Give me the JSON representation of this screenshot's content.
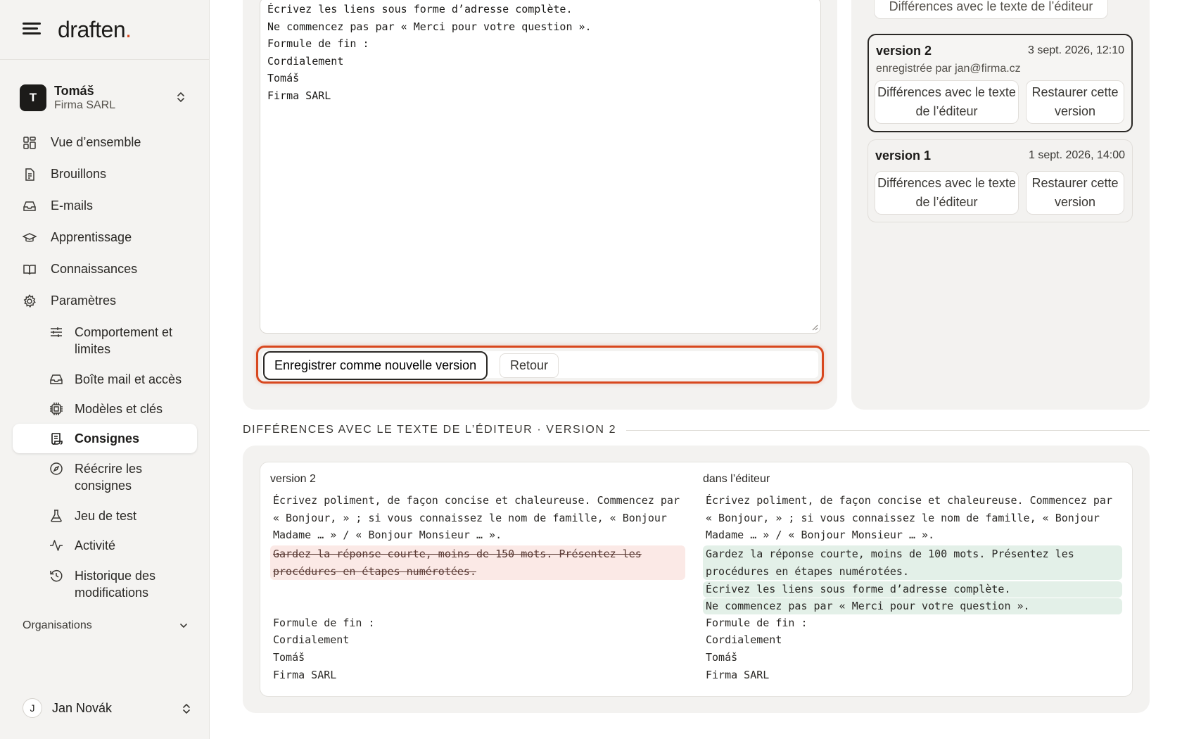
{
  "brand": {
    "name": "draften",
    "dot": "."
  },
  "account": {
    "initial": "T",
    "name": "Tomáš",
    "org": "Firma SARL"
  },
  "nav": [
    {
      "label": "Vue d’ensemble"
    },
    {
      "label": "Brouillons"
    },
    {
      "label": "E-mails"
    },
    {
      "label": "Apprentissage"
    },
    {
      "label": "Connaissances"
    },
    {
      "label": "Paramètres"
    }
  ],
  "subnav": [
    {
      "label": "Comportement et limites"
    },
    {
      "label": "Boîte mail et accès"
    },
    {
      "label": "Modèles et clés"
    },
    {
      "label": "Consignes"
    },
    {
      "label": "Réécrire les consignes"
    },
    {
      "label": "Jeu de test"
    },
    {
      "label": "Activité"
    },
    {
      "label": "Historique des modifications"
    }
  ],
  "orgs_label": "Organisations",
  "user": {
    "initial": "J",
    "name": "Jan Novák"
  },
  "editor": {
    "text": "Écrivez les liens sous forme d’adresse complète.\nNe commencez pas par « Merci pour votre question ».\nFormule de fin :\nCordialement\nTomáš\nFirma SARL",
    "save_label": "Enregistrer comme nouvelle version",
    "back_label": "Retour"
  },
  "versions": {
    "top_partial_label": "Différences avec le texte de l’éditeur",
    "items": [
      {
        "title": "version 2",
        "date": "3 sept. 2026, 12:10",
        "by": "enregistrée par jan@firma.cz",
        "diff_label": "Différences avec le texte de l’éditeur",
        "restore_label": "Restaurer cette version"
      },
      {
        "title": "version 1",
        "date": "1 sept. 2026, 14:00",
        "diff_label": "Différences avec le texte de l’éditeur",
        "restore_label": "Restaurer cette version"
      }
    ]
  },
  "diff": {
    "section_title": "DIFFÉRENCES AVEC LE TEXTE DE L’ÉDITEUR · VERSION 2",
    "left": {
      "header": "version 2",
      "common_top": [
        "Écrivez poliment, de façon concise et chaleureuse. Commencez par",
        "« Bonjour, » ; si vous connaissez le nom de famille, « Bonjour",
        "Madame … » / « Bonjour Monsieur … »."
      ],
      "removed": [
        "Gardez la réponse courte, moins de 150 mots. Présentez les",
        "procédures en étapes numérotées."
      ],
      "common_bottom": [
        "Formule de fin :",
        "Cordialement",
        "Tomáš",
        "Firma SARL"
      ]
    },
    "right": {
      "header": "dans l’éditeur",
      "common_top": [
        "Écrivez poliment, de façon concise et chaleureuse. Commencez par",
        "« Bonjour, » ; si vous connaissez le nom de famille, « Bonjour",
        "Madame … » / « Bonjour Monsieur … »."
      ],
      "added_1": [
        "Gardez la réponse courte, moins de 100 mots. Présentez les",
        "procédures en étapes numérotées."
      ],
      "added_2": [
        "Écrivez les liens sous forme d’adresse complète."
      ],
      "added_3": [
        "Ne commencez pas par « Merci pour votre question »."
      ],
      "common_bottom": [
        "Formule de fin :",
        "Cordialement",
        "Tomáš",
        "Firma SARL"
      ]
    }
  },
  "colors": {
    "accent": "#d8481f",
    "removed_bg": "#fbe9e6",
    "added_bg": "#e3f0e8"
  }
}
